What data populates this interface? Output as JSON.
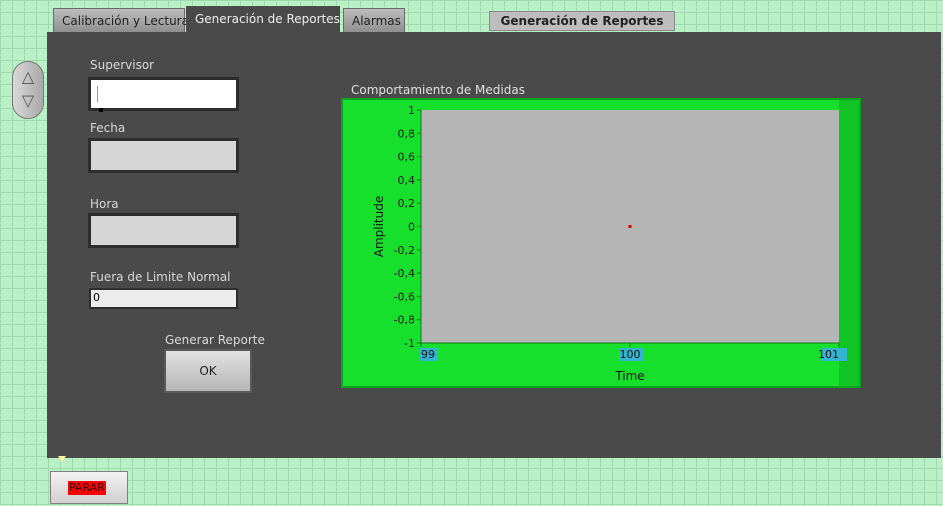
{
  "tabs": [
    {
      "label": "Calibración y Lectura",
      "active": false
    },
    {
      "label": "Generación de Reportes",
      "active": true
    },
    {
      "label": "Alarmas",
      "active": false
    }
  ],
  "header_title": "Generación de Reportes",
  "form": {
    "supervisor_label": "Supervisor",
    "supervisor_value": "",
    "fecha_label": "Fecha",
    "fecha_value": "",
    "hora_label": "Hora",
    "hora_value": "",
    "fuera_label": "Fuera de Limite Normal",
    "fuera_value": "0",
    "generar_label": "Generar Reporte",
    "ok_label": "OK"
  },
  "chart_title": "Comportamiento de Medidas",
  "parar_label": "PARAR",
  "colors": {
    "panel": "#4a4a4a",
    "chart_frame": "#16e02c",
    "plot_area": "#b5b5b5",
    "point": "#e00000",
    "parar": "#ff0000"
  },
  "chart_data": {
    "type": "scatter",
    "title": "",
    "xlabel": "Time",
    "ylabel": "Amplitude",
    "xlim": [
      99,
      101
    ],
    "ylim": [
      -1,
      1
    ],
    "x_ticks": [
      "99",
      "100",
      "101"
    ],
    "y_ticks": [
      "1",
      "0,8",
      "0,6",
      "0,4",
      "0,2",
      "0",
      "-0,2",
      "-0,4",
      "-0,6",
      "-0,8",
      "-1"
    ],
    "series": [
      {
        "x": [
          100
        ],
        "y": [
          0
        ]
      }
    ],
    "grid": false
  }
}
